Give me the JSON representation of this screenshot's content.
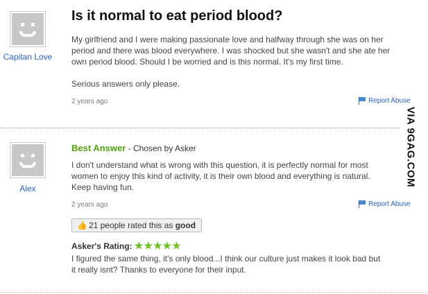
{
  "question": {
    "title": "Is it normal to eat period blood?",
    "asker": "Capitan Love",
    "body_lines": [
      "My girlfriend and I were making passionate love and halfway through she was on her",
      "period and there was blood everywhere. I was shocked but she wasn't and she ate her",
      "own period blood. Should I be worried and is this normal. It's my first time."
    ],
    "note": "Serious answers only please.",
    "time": "2 years ago",
    "report_label": "Report Abuse"
  },
  "answer": {
    "best_label": "Best Answer",
    "chosen_text": " - Chosen by Asker",
    "answerer": "Alex",
    "body_lines": [
      "I don't understand what is wrong with this question, it is perfectly normal for most",
      "women to enjoy this kind of activity, it is their own blood and everything is natural.",
      "Keep having fun."
    ],
    "time": "2 years ago",
    "report_label": "Report Abuse",
    "rated_prefix": "21 people rated this as ",
    "rated_value": "good",
    "asker_rating_label": "Asker's Rating:",
    "asker_rating_stars": 5,
    "asker_rating_text": "★★★★★",
    "asker_comment_lines": [
      "I figured the same thing, it's only blood...I think our culture just makes it look bad but",
      "it really isnt? Thanks to everyone for their input."
    ]
  },
  "watermark": "VIA 9GAG.COM",
  "colors": {
    "link": "#2a63b3",
    "best_answer": "#4fa30f",
    "stars": "#6cc21f"
  },
  "icons": {
    "avatar": "smiley-avatar-icon",
    "report": "flag-icon",
    "rated": "thumbs-up-icon"
  }
}
